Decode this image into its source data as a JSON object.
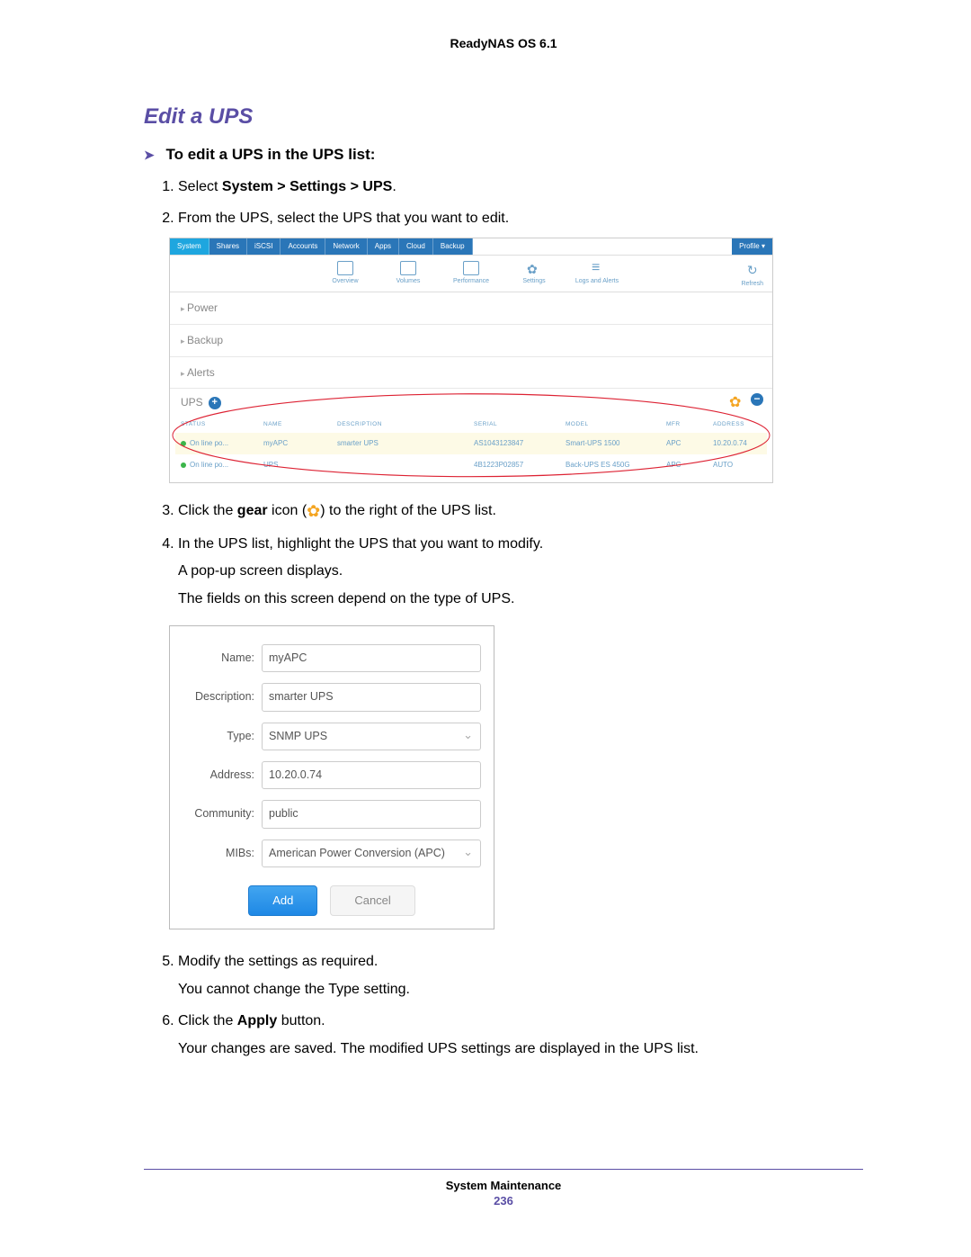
{
  "header": {
    "product": "ReadyNAS OS 6.1"
  },
  "section": {
    "title": "Edit a UPS"
  },
  "instruction": {
    "header": "To edit a UPS in the UPS list:",
    "steps": {
      "s1_a": "Select ",
      "s1_b": "System > Settings > UPS",
      "s1_c": ".",
      "s2": "From the UPS, select the UPS that you want to edit.",
      "s3_a": "Click the ",
      "s3_b": "gear",
      "s3_c": " icon (",
      "s3_d": ") to the right of the UPS list.",
      "s4": "In the UPS list, highlight the UPS that you want to modify.",
      "s4_sub1": "A pop-up screen displays.",
      "s4_sub2": "The fields on this screen depend on the type of UPS.",
      "s5": "Modify the settings as required.",
      "s5_sub": "You cannot change the Type setting.",
      "s6_a": "Click the ",
      "s6_b": "Apply",
      "s6_c": " button.",
      "s6_sub": "Your changes are saved. The modified UPS settings are displayed in the UPS list."
    }
  },
  "ui": {
    "tabs": [
      "System",
      "Shares",
      "iSCSI",
      "Accounts",
      "Network",
      "Apps",
      "Cloud",
      "Backup"
    ],
    "profile": "Profile ▾",
    "toolbar": {
      "overview": "Overview",
      "volumes": "Volumes",
      "performance": "Performance",
      "settings": "Settings",
      "logs": "Logs and Alerts",
      "refresh": "Refresh"
    },
    "sections": {
      "power": "Power",
      "backup": "Backup",
      "alerts": "Alerts",
      "ups": "UPS"
    },
    "table": {
      "headers": {
        "status": "STATUS",
        "name": "NAME",
        "description": "DESCRIPTION",
        "serial": "SERIAL",
        "model": "MODEL",
        "mfr": "MFR",
        "address": "ADDRESS"
      },
      "rows": [
        {
          "status": "On line po...",
          "name": "myAPC",
          "desc": "smarter UPS",
          "serial": "AS1043123847",
          "model": "Smart-UPS 1500",
          "mfr": "APC",
          "addr": "10.20.0.74"
        },
        {
          "status": "On line po...",
          "name": "UPS",
          "desc": "",
          "serial": "4B1223P02857",
          "model": "Back-UPS ES 450G",
          "mfr": "APC",
          "addr": "AUTO"
        }
      ]
    }
  },
  "dialog": {
    "labels": {
      "name": "Name:",
      "description": "Description:",
      "type": "Type:",
      "address": "Address:",
      "community": "Community:",
      "mibs": "MIBs:"
    },
    "values": {
      "name": "myAPC",
      "description": "smarter UPS",
      "type": "SNMP UPS",
      "address": "10.20.0.74",
      "community": "public",
      "mibs": "American Power Conversion (APC)"
    },
    "buttons": {
      "add": "Add",
      "cancel": "Cancel"
    }
  },
  "footer": {
    "chapter": "System Maintenance",
    "page": "236"
  }
}
